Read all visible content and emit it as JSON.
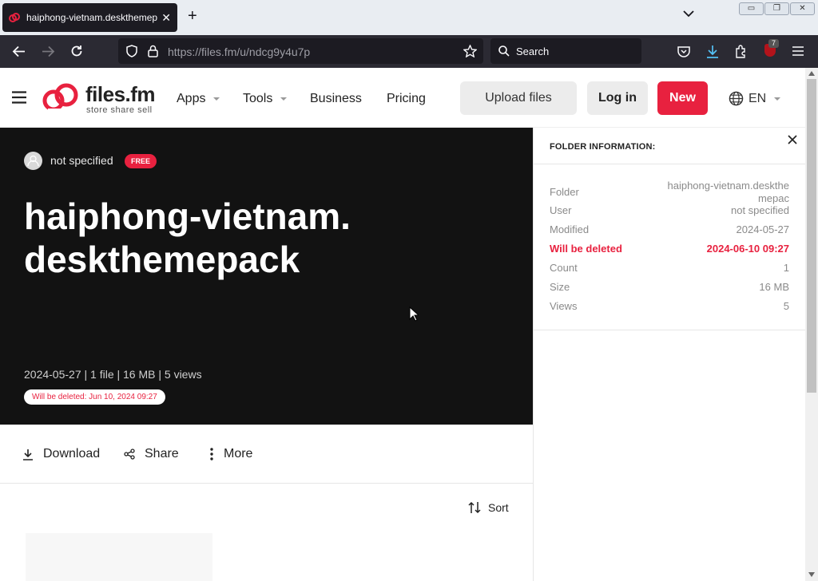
{
  "browser": {
    "tab_title": "haiphong-vietnam.deskthemepack",
    "url_host": "https://files.fm",
    "url_path": "/u/ndcg9y4u7p",
    "search_placeholder": "Search",
    "addon_badge": "7"
  },
  "site": {
    "logo_text": "files.fm",
    "logo_tagline": "store share sell",
    "nav": [
      "Apps",
      "Tools",
      "Business",
      "Pricing"
    ],
    "upload_label": "Upload files",
    "login_label": "Log in",
    "new_label": "New",
    "lang_label": "EN",
    "accent": "#e8213f"
  },
  "folder": {
    "user": "not specified",
    "plan_badge": "FREE",
    "title": "haiphong-vietnam.deskthemepack",
    "summary": "2024-05-27 | 1 file | 16 MB | 5 views",
    "delete_notice": "Will be deleted: Jun 10, 2024 09:27"
  },
  "actions": {
    "download": "Download",
    "share": "Share",
    "more": "More",
    "sort": "Sort"
  },
  "panel": {
    "heading": "FOLDER INFORMATION:",
    "rows": [
      {
        "key": "Folder",
        "value": "haiphong-vietnam.deskthemepac"
      },
      {
        "key": "User",
        "value": "not specified"
      },
      {
        "key": "Modified",
        "value": "2024-05-27"
      },
      {
        "key": "Will be deleted",
        "value": "2024-06-10 09:27"
      },
      {
        "key": "Count",
        "value": "1"
      },
      {
        "key": "Size",
        "value": "16 MB"
      },
      {
        "key": "Views",
        "value": "5"
      }
    ]
  }
}
